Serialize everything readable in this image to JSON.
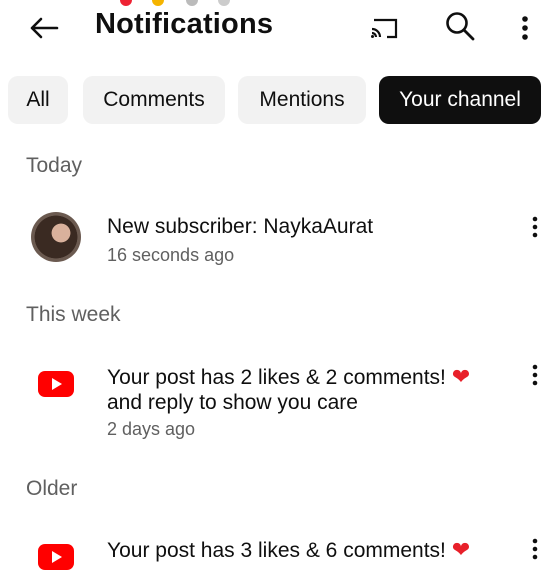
{
  "header": {
    "title": "Notifications",
    "icons": [
      "back-arrow-icon",
      "cast-icon",
      "search-icon",
      "more-vert-icon"
    ]
  },
  "filters": {
    "chips": [
      {
        "label": "All",
        "selected": false
      },
      {
        "label": "Comments",
        "selected": false
      },
      {
        "label": "Mentions",
        "selected": false
      },
      {
        "label": "Your channel",
        "selected": true
      }
    ]
  },
  "sections": [
    {
      "label": "Today",
      "items": [
        {
          "text": "New subscriber: NaykaAurat",
          "time": "16 seconds ago",
          "icon": "avatar"
        }
      ]
    },
    {
      "label": "This week",
      "items": [
        {
          "line1": "Your post has 2 likes & 2 comments!",
          "line2": "and reply to show you care",
          "time": "2 days ago",
          "icon": "youtube-icon"
        }
      ]
    },
    {
      "label": "Older",
      "items": [
        {
          "line1": "Your post has 3 likes & 6 comments!",
          "icon": "youtube-icon"
        }
      ]
    }
  ],
  "colors": {
    "accent_red": "#ff0000",
    "heart": "#e8202a",
    "chip_selected_bg": "#0f0f0f",
    "chip_bg": "#f2f2f2",
    "secondary_text": "#606060"
  }
}
